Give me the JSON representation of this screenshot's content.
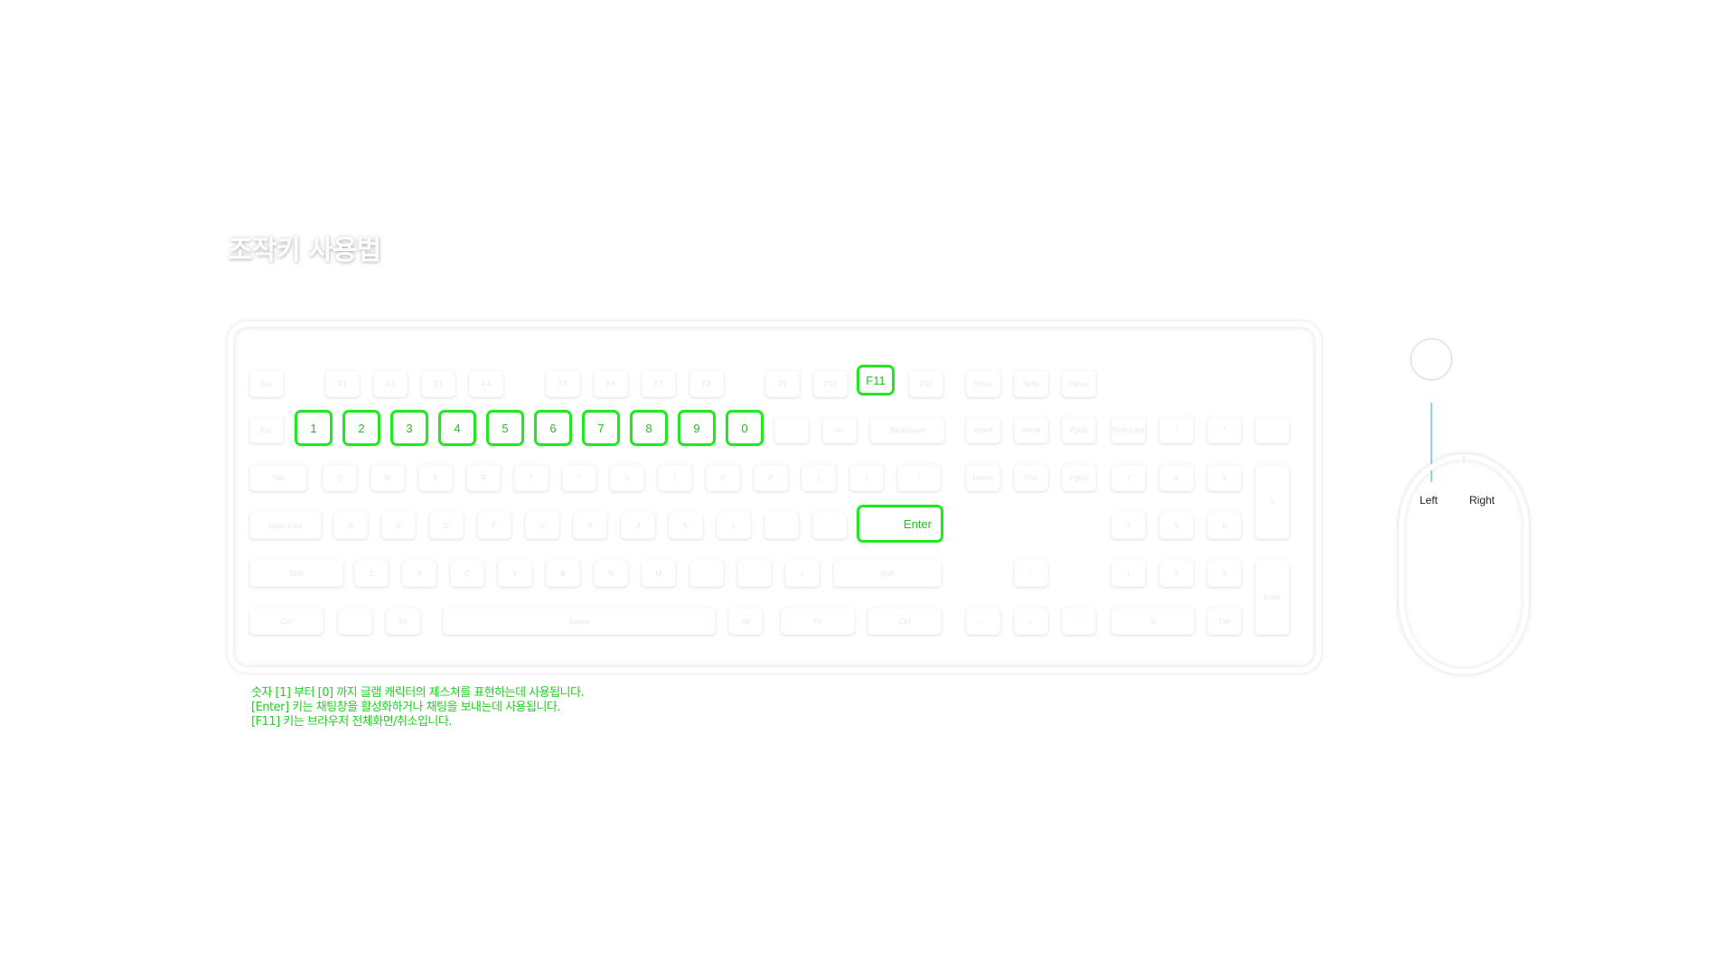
{
  "title": "조작키 사용법",
  "keyboard": {
    "row_fn": [
      "Esc",
      "F1",
      "F2",
      "F3",
      "F4",
      "F5",
      "F6",
      "F7",
      "F8",
      "F9",
      "F10",
      "F11",
      "F12",
      "Prtsc",
      "Scrlk",
      "Pause"
    ],
    "row_num": [
      "Esc",
      "1",
      "2",
      "3",
      "4",
      "5",
      "6",
      "7",
      "8",
      "9",
      "0",
      "-",
      "+/=",
      "Backspace",
      "Insert",
      "Home",
      "PgUp",
      "Num Lock",
      "/",
      "*",
      "-"
    ],
    "row_tab": [
      "Tab",
      "Q",
      "W",
      "E",
      "R",
      "T",
      "Y",
      "U",
      "I",
      "O",
      "P",
      "[",
      "]",
      "\\",
      "Delete",
      "End",
      "PgDn",
      "7",
      "8",
      "9",
      "+"
    ],
    "row_caps": [
      "Caps Lock",
      "A",
      "S",
      "D",
      "F",
      "G",
      "H",
      "J",
      "K",
      "L",
      ";",
      "'",
      "Enter",
      "4",
      "5",
      "6"
    ],
    "row_shift": [
      "Shift",
      "Z",
      "X",
      "C",
      "V",
      "B",
      "N",
      "M",
      ",",
      ".",
      "/",
      "Shift",
      "↑",
      "1",
      "2",
      "3",
      "Enter"
    ],
    "row_ctrl": [
      "Ctrl",
      "",
      "Alt",
      "Space",
      "Alt",
      "Fn",
      "Ctrl",
      "←",
      "↓",
      "→",
      "0",
      "Del"
    ]
  },
  "notes": {
    "line1": "숫자 [1] 부터 [0] 까지 글램 캐릭터의 제스쳐를 표현하는데 사용됩니다.",
    "line2": "[Enter] 키는 채팅창을 활성화하거나 채팅을 보내는데 사용됩니다.",
    "line3": "[F11] 키는 브라우저 전체화면/취소입니다."
  },
  "mouse": {
    "left_label": "Left",
    "right_label": "Right"
  },
  "colors": {
    "highlight": "#22e822",
    "cable": "#8fd4e8"
  }
}
